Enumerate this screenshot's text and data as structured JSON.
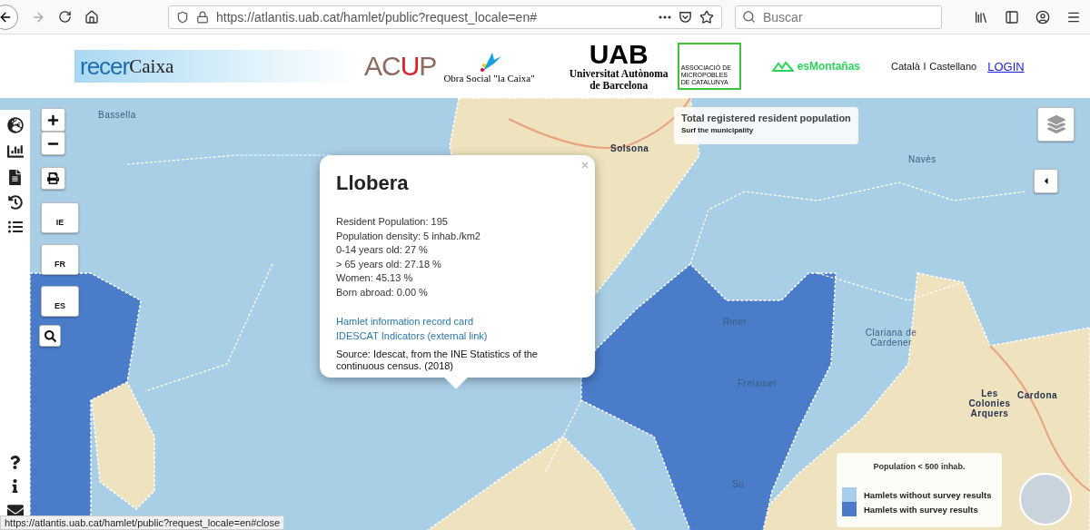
{
  "browser": {
    "url": "https://atlantis.uab.cat/hamlet/public?request_locale=en#",
    "search_placeholder": "Buscar",
    "status_url": "https://atlantis.uab.cat/hamlet/public?request_locale=en#close"
  },
  "header": {
    "logos": [
      {
        "kind": "recer",
        "parts": [
          "recer",
          "Caixa"
        ]
      },
      {
        "kind": "acup",
        "parts": [
          "AC",
          "U",
          "P"
        ]
      },
      {
        "kind": "lacaixa",
        "parts": [
          "Obra Social \"la Caixa\""
        ]
      },
      {
        "kind": "uab",
        "parts": [
          "UAB",
          "Universitat Autònoma",
          "de Barcelona"
        ]
      },
      {
        "kind": "micropobles",
        "parts": [
          "ASSOCIACIÓ DE",
          "MICROPOBLES",
          "DE CATALUNYA"
        ]
      },
      {
        "kind": "esmontanas",
        "parts": [
          "esMontañas"
        ]
      }
    ],
    "languages": [
      "Català",
      "Castellano"
    ],
    "language_separator": "l",
    "login": "LOGIN"
  },
  "map": {
    "language_buttons": [
      "IE",
      "FR",
      "ES"
    ],
    "place_labels": [
      "Bassella",
      "Solsona",
      "Navès",
      "Riner",
      "Freixinet",
      "Clariana de Cardener",
      "Les Colonies Arquers",
      "Cardona",
      "Su"
    ],
    "info_box": {
      "title": "Total registered resident population",
      "subtitle": "Surf the municipality"
    },
    "popup": {
      "title": "Llobera",
      "stats": [
        "Resident Population: 195",
        "Population density: 5 inhab./km2",
        "0-14 years old: 27 %",
        "> 65 years old: 27.18 %",
        "Women: 45.13 %",
        "Born abroad: 0.00 %"
      ],
      "links": [
        "Hamlet information record card",
        "IDESCAT Indicators (external link)"
      ],
      "source": "Source: Idescat, from the INE Statistics of the continuous census. (2018)"
    },
    "legend": {
      "title": "Population < 500 inhab.",
      "items": [
        {
          "label": "Hamlets without survey results",
          "color": "#a8cdea"
        },
        {
          "label": "Hamlets with survey results",
          "color": "#4a7ac8"
        }
      ]
    }
  }
}
